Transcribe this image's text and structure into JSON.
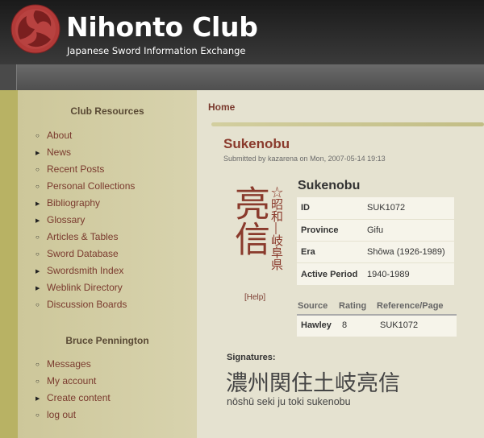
{
  "site": {
    "title": "Nihonto Club",
    "slogan": "Japanese Sword Information Exchange"
  },
  "sidebar": {
    "resources_title": "Club Resources",
    "resources": [
      {
        "label": "About",
        "bullet": "dot"
      },
      {
        "label": "News",
        "bullet": "tri"
      },
      {
        "label": "Recent Posts",
        "bullet": "dot"
      },
      {
        "label": "Personal Collections",
        "bullet": "dot"
      },
      {
        "label": "Bibliography",
        "bullet": "tri"
      },
      {
        "label": "Glossary",
        "bullet": "tri"
      },
      {
        "label": "Articles & Tables",
        "bullet": "dot"
      },
      {
        "label": "Sword Database",
        "bullet": "dot"
      },
      {
        "label": "Swordsmith Index",
        "bullet": "tri"
      },
      {
        "label": "Weblink Directory",
        "bullet": "tri"
      },
      {
        "label": "Discussion Boards",
        "bullet": "dot"
      }
    ],
    "user_title": "Bruce Pennington",
    "user_menu": [
      {
        "label": "Messages",
        "bullet": "dot"
      },
      {
        "label": "My account",
        "bullet": "dot"
      },
      {
        "label": "Create content",
        "bullet": "tri"
      },
      {
        "label": "log out",
        "bullet": "dot"
      }
    ]
  },
  "breadcrumb": "Home",
  "node": {
    "title": "Sukenobu",
    "submitted": "Submitted by kazarena on Mon, 2007-05-14 19:13",
    "kanji_big": "亮信",
    "kanji_small": "☆昭和―岐阜県",
    "help": "[Help]",
    "name": "Sukenobu",
    "fields": [
      {
        "key": "ID",
        "value": "SUK1072"
      },
      {
        "key": "Province",
        "value": "Gifu"
      },
      {
        "key": "Era",
        "value": "Shōwa (1926-1989)"
      },
      {
        "key": "Active Period",
        "value": "1940-1989"
      }
    ],
    "sources_header": {
      "source": "Source",
      "rating": "Rating",
      "reference": "Reference/Page"
    },
    "sources": [
      {
        "source": "Hawley",
        "rating": "8",
        "reference": "SUK1072"
      }
    ],
    "signatures_label": "Signatures:",
    "signature_kanji": "濃州関住土岐亮信",
    "signature_romaji": "nōshū seki ju toki sukenobu"
  },
  "colors": {
    "accent": "#8a3a2c",
    "link": "#7a3a2e",
    "sidebar_bg": "#cdc79a",
    "content_bg": "#e5e2d0",
    "header_bg": "#1a1a1a"
  }
}
